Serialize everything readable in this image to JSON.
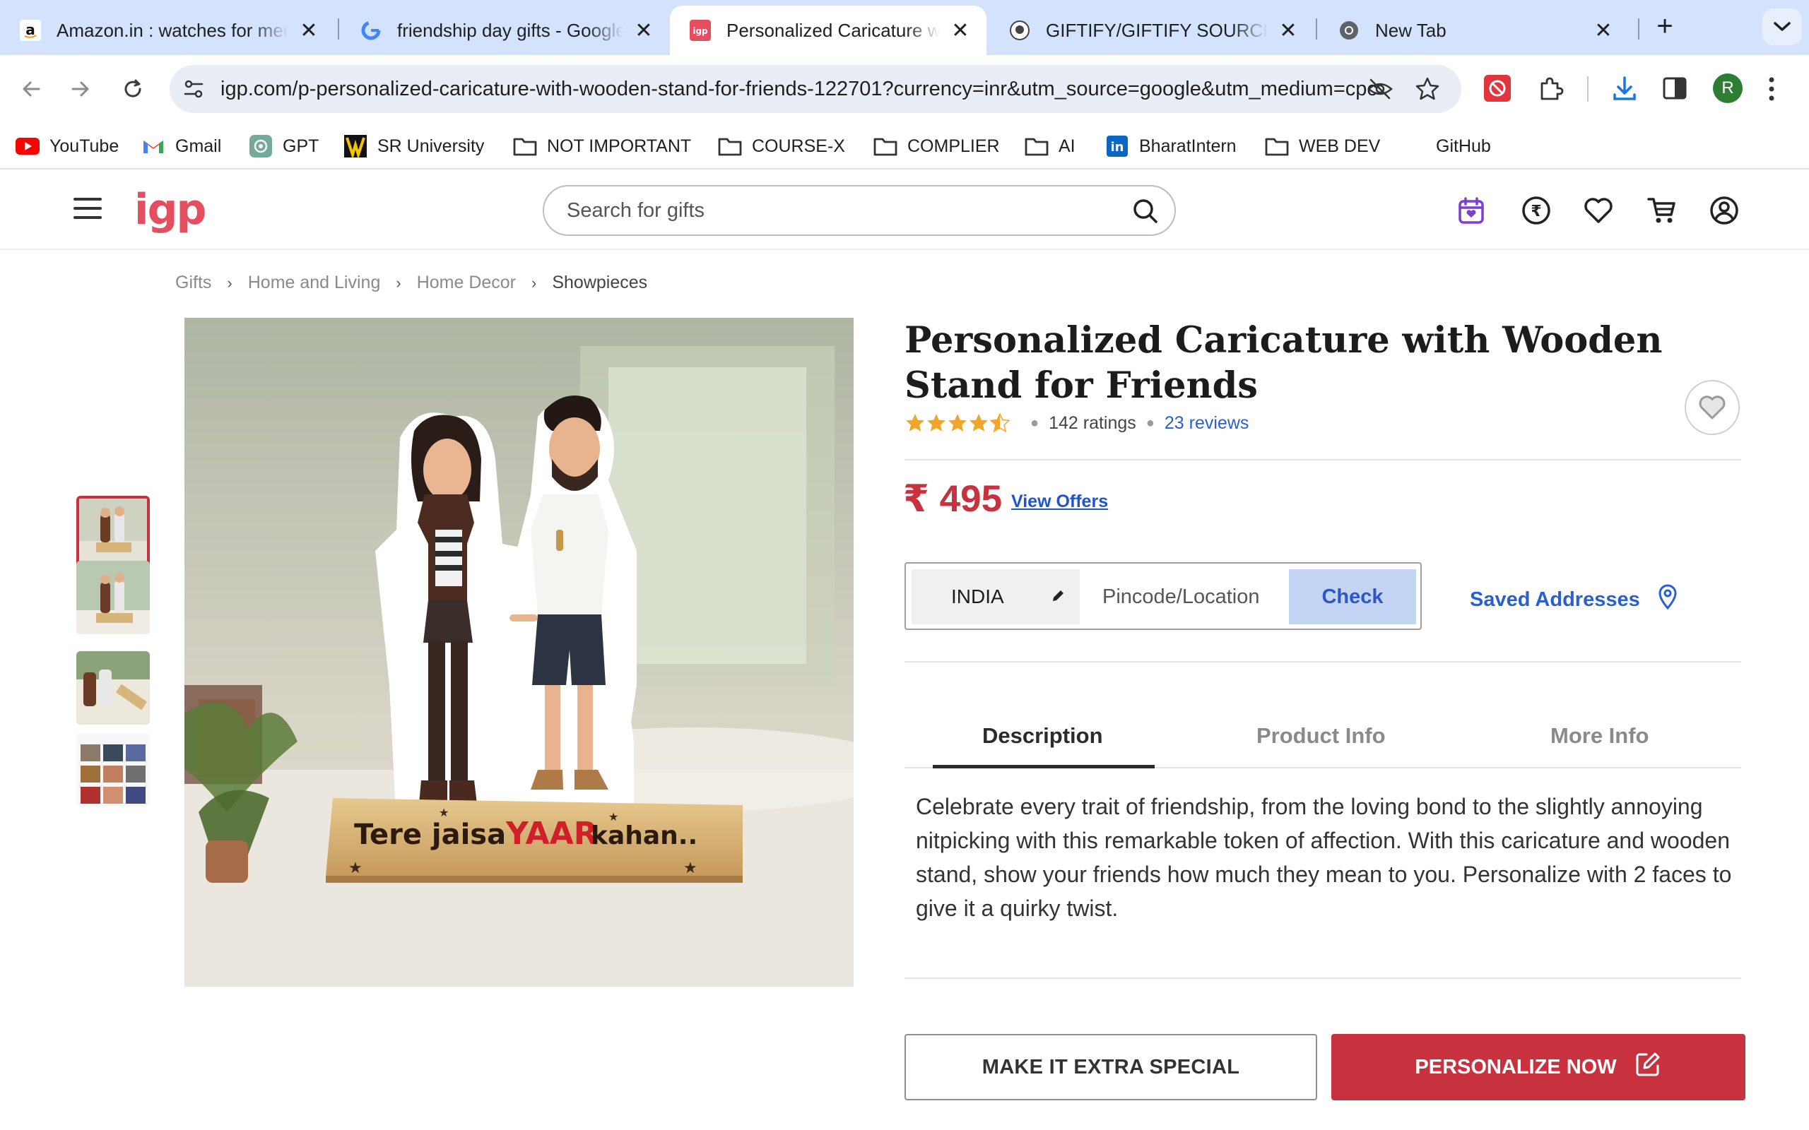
{
  "browser": {
    "tabs": [
      {
        "title": "Amazon.in : watches for men",
        "favicon": "amazon-icon"
      },
      {
        "title": "friendship day gifts - Google Search",
        "favicon": "google-icon"
      },
      {
        "title": "Personalized Caricature with Wooden Stand for Friends",
        "favicon": "igp-icon",
        "active": true
      },
      {
        "title": "GIFTIFY/GIFTIFY SOURCE/backend",
        "favicon": "github-icon"
      },
      {
        "title": "New Tab",
        "favicon": "chrome-icon"
      }
    ],
    "new_tab_label": "+",
    "close_glyph": "✕",
    "url": "igp.com/p-personalized-caricature-with-wooden-stand-for-friends-122701?currency=inr&utm_source=google&utm_medium=cpc",
    "profile_initial": "R",
    "bookmarks": [
      {
        "label": "YouTube",
        "icon": "youtube-icon"
      },
      {
        "label": "Gmail",
        "icon": "gmail-icon"
      },
      {
        "label": "GPT",
        "icon": "openai-icon"
      },
      {
        "label": "SR University",
        "icon": "sr-university-icon"
      },
      {
        "label": "NOT IMPORTANT",
        "icon": "folder-icon"
      },
      {
        "label": "COURSE-X",
        "icon": "folder-icon"
      },
      {
        "label": "COMPLIER",
        "icon": "folder-icon"
      },
      {
        "label": "AI",
        "icon": "folder-icon"
      },
      {
        "label": "BharatIntern",
        "icon": "linkedin-icon"
      },
      {
        "label": "WEB DEV",
        "icon": "folder-icon"
      },
      {
        "label": "GitHub",
        "icon": ""
      }
    ]
  },
  "site": {
    "logo": "igp",
    "search_placeholder": "Search for gifts",
    "brand_color": "#e54e5f",
    "accent_color": "#c8323f",
    "link_color": "#2a5fd0"
  },
  "breadcrumb": [
    "Gifts",
    "Home and Living",
    "Home Decor",
    "Showpieces"
  ],
  "breadcrumb_separator": "›",
  "product": {
    "title": "Personalized Caricature with Wooden Stand for Friends",
    "rating": 4.5,
    "ratings_text": "142 ratings",
    "reviews_text": "23 reviews",
    "currency_symbol": "₹",
    "price": "495",
    "offers_link": "View Offers",
    "image": {
      "stand_text_1": "Tere jaisa",
      "stand_text_2": "YAAR",
      "stand_text_3": "kahan.."
    },
    "thumbnail_count": 4,
    "selected_thumbnail": 1
  },
  "delivery": {
    "country": "INDIA",
    "pincode_placeholder": "Pincode/Location",
    "check_label": "Check",
    "saved_addresses_label": "Saved Addresses"
  },
  "tabs": [
    {
      "label": "Description",
      "active": true
    },
    {
      "label": "Product Info",
      "active": false
    },
    {
      "label": "More Info",
      "active": false
    }
  ],
  "description": "Celebrate every trait of friendship, from the loving bond to the slightly annoying nitpicking with this remarkable token of affection. With this caricature and wooden stand, show your friends how much they mean to you. Personalize with 2 faces to give it a quirky twist.",
  "actions": {
    "extra_special_label": "MAKE IT EXTRA SPECIAL",
    "personalize_label": "PERSONALIZE NOW"
  }
}
